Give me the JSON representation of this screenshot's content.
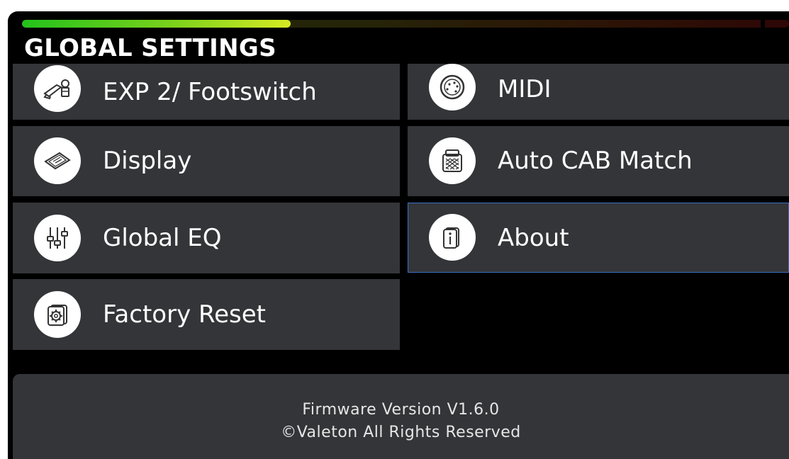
{
  "header": {
    "title": "GLOBAL SETTINGS"
  },
  "level_meter": {
    "level": 0.35
  },
  "menu": {
    "items": [
      {
        "label": "EXP 2/ Footswitch",
        "icon": "pedal-footswitch-icon"
      },
      {
        "label": "MIDI",
        "icon": "midi-connector-icon"
      },
      {
        "label": "Display",
        "icon": "display-screen-icon"
      },
      {
        "label": "Auto CAB Match",
        "icon": "amp-cabinet-icon"
      },
      {
        "label": "Global EQ",
        "icon": "eq-sliders-icon"
      },
      {
        "label": "About",
        "icon": "info-icon"
      },
      {
        "label": "Factory Reset",
        "icon": "reset-gear-icon"
      }
    ],
    "selected": "About"
  },
  "footer": {
    "firmware": "Firmware Version V1.6.0",
    "copyright": "©Valeton All Rights Reserved"
  },
  "colors": {
    "background": "#000000",
    "tile": "#333538",
    "selection_border": "#3b6fc4",
    "meter_green": "#24c21c",
    "meter_yellow": "#d6ea24"
  }
}
